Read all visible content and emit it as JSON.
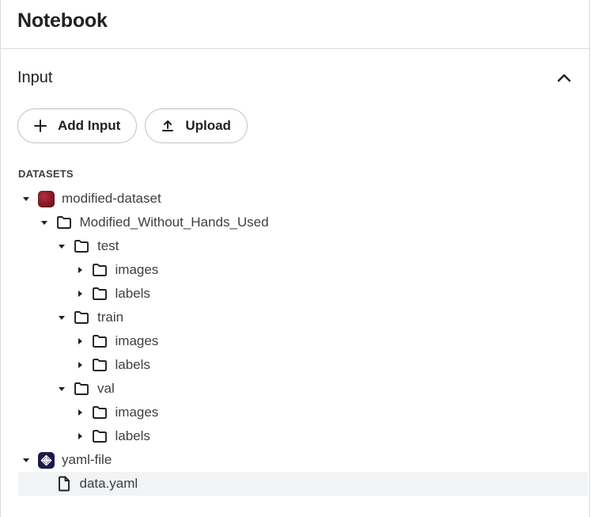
{
  "panel": {
    "title": "Notebook"
  },
  "input_section": {
    "title": "Input",
    "collapse_icon": "chevron-up-icon",
    "buttons": [
      {
        "label": "Add Input",
        "icon": "plus-icon"
      },
      {
        "label": "Upload",
        "icon": "upload-icon"
      }
    ],
    "datasets_heading": "DATASETS"
  },
  "tree": [
    {
      "label": "modified-dataset",
      "level": 0,
      "expanded": true,
      "icon": "dataset-thumbnail-icon"
    },
    {
      "label": "Modified_Without_Hands_Used",
      "level": 1,
      "expanded": true,
      "icon": "folder-icon"
    },
    {
      "label": "test",
      "level": 2,
      "expanded": true,
      "icon": "folder-icon"
    },
    {
      "label": "images",
      "level": 3,
      "expanded": false,
      "icon": "folder-icon"
    },
    {
      "label": "labels",
      "level": 3,
      "expanded": false,
      "icon": "folder-icon"
    },
    {
      "label": "train",
      "level": 2,
      "expanded": true,
      "icon": "folder-icon"
    },
    {
      "label": "images",
      "level": 3,
      "expanded": false,
      "icon": "folder-icon"
    },
    {
      "label": "labels",
      "level": 3,
      "expanded": false,
      "icon": "folder-icon"
    },
    {
      "label": "val",
      "level": 2,
      "expanded": true,
      "icon": "folder-icon"
    },
    {
      "label": "images",
      "level": 3,
      "expanded": false,
      "icon": "folder-icon"
    },
    {
      "label": "labels",
      "level": 3,
      "expanded": false,
      "icon": "folder-icon"
    },
    {
      "label": "yaml-file",
      "level": 0,
      "expanded": true,
      "icon": "model-thumbnail-icon"
    },
    {
      "label": "data.yaml",
      "level": 1,
      "expanded": null,
      "icon": "file-icon",
      "selected": true
    }
  ],
  "colors": {
    "selected_row_bg": "#f1f3f4",
    "dataset_thumb": "#8a1d28",
    "yaml_thumb": "#1e1b4b"
  }
}
